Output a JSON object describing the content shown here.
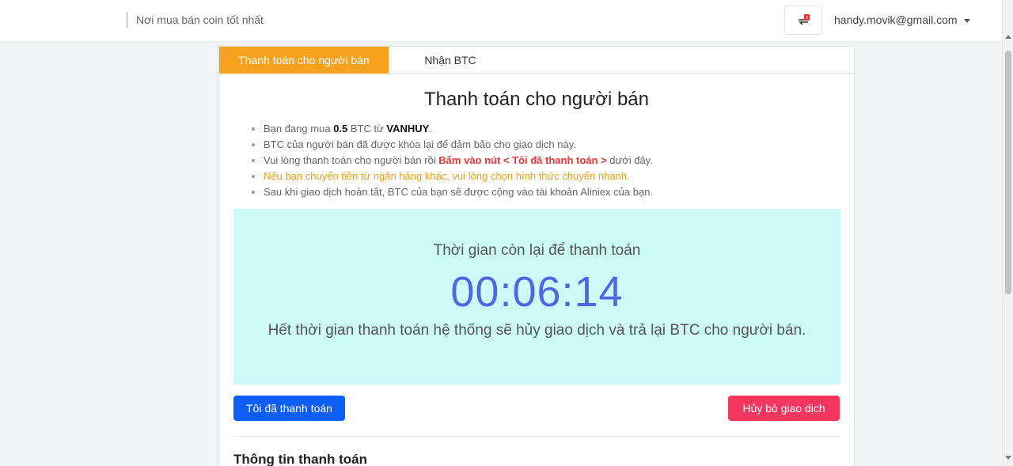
{
  "header": {
    "tagline": "Nơi mua bán coin tốt nhất",
    "user_email": "handy.movik@gmail.com",
    "notification_icon": "notification-transfer-icon"
  },
  "tabs": [
    {
      "label": "Thanh toán cho người bán",
      "active": true
    },
    {
      "label": "Nhận BTC",
      "active": false
    }
  ],
  "main": {
    "title": "Thanh toán cho người bán",
    "info": {
      "line1_prefix": "Bạn đang mua ",
      "line1_amount": "0.5",
      "line1_mid": " BTC từ ",
      "line1_seller": "VANHUY",
      "line1_suffix": ".",
      "line2": "BTC của người bán đã được khóa lại để đảm bảo cho giao dịch này.",
      "line3_prefix": "Vui lòng thanh toán cho người bán rồi ",
      "line3_highlight": "Bấm vào nút < Tôi đã thanh toán >",
      "line3_suffix": " dưới đây.",
      "line4": "Nếu bạn chuyển tiền từ ngân hàng khác, vui lòng chọn hình thức chuyển nhanh.",
      "line5": "Sau khi giao dịch hoàn tất, BTC của bạn sẽ được cộng vào tài khoản Aliniex của bạn."
    },
    "timer": {
      "label": "Thời gian còn lại để thanh toán",
      "value": "00:06:14",
      "note": "Hết thời gian thanh toán hệ thống sẽ hủy giao dịch và trả lại BTC cho người bán."
    },
    "buttons": {
      "paid": "Tôi đã thanh toán",
      "cancel": "Hủy bỏ giao dịch"
    },
    "section_title": "Thông tin thanh toán"
  },
  "colors": {
    "tab_active": "#f6a21e",
    "timer_bg": "#ccfaf6",
    "timer_text": "#5166e6",
    "primary": "#0d5ef7",
    "danger": "#f3365e",
    "highlight_red": "#e53935",
    "notice_orange": "#f39c12"
  }
}
